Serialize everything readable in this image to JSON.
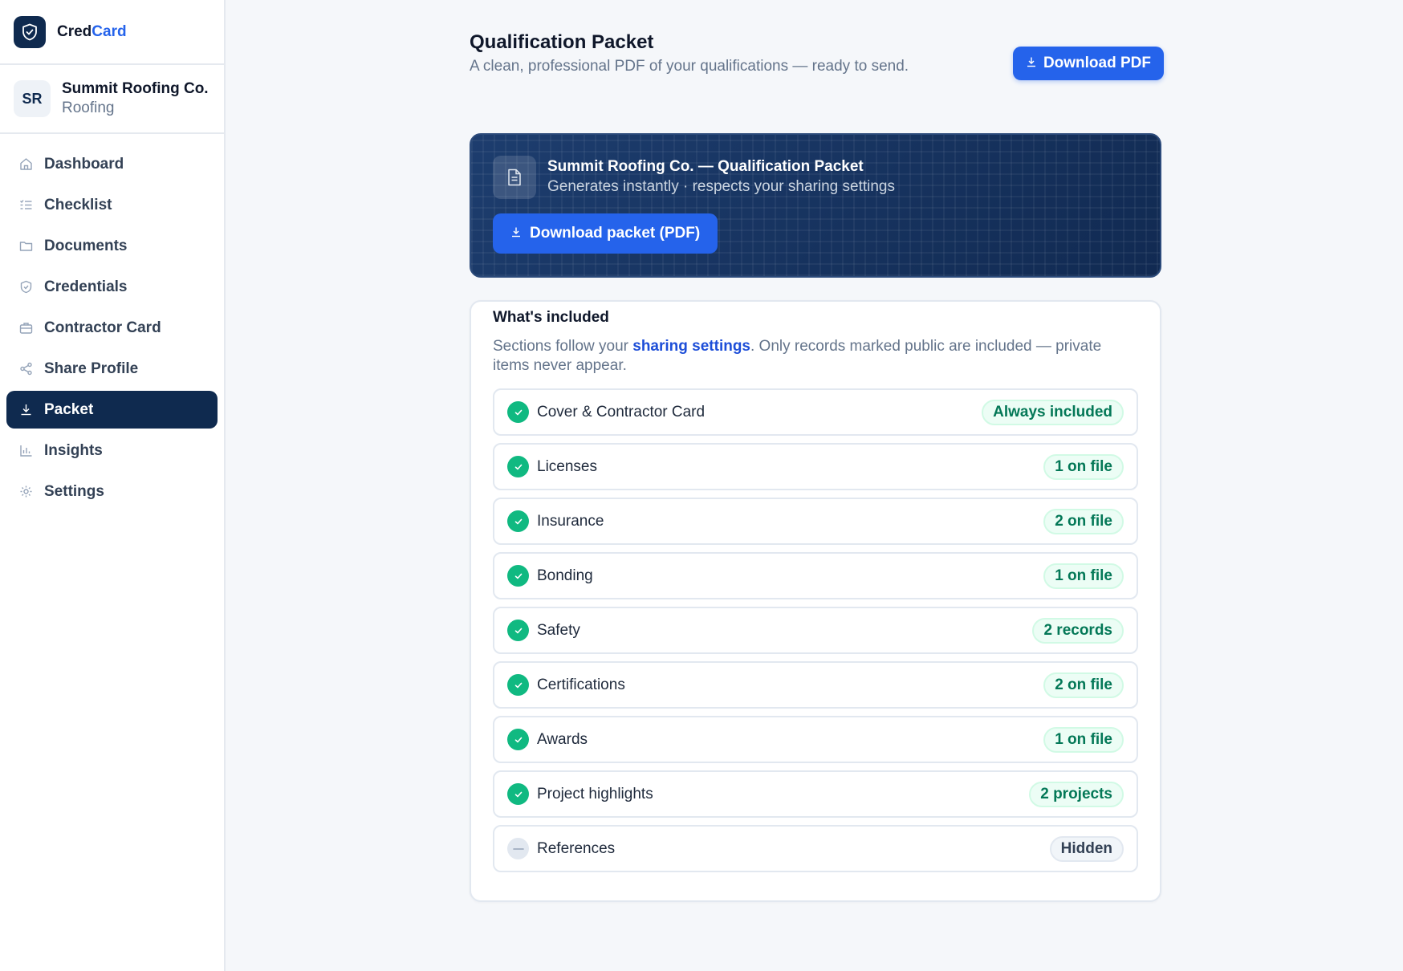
{
  "brand": {
    "name_part1": "Cred",
    "name_part2": "Card",
    "icon": "shield-check-icon"
  },
  "account": {
    "initials": "SR",
    "name": "Summit Roofing Co.",
    "trade": "Roofing"
  },
  "nav": [
    {
      "label": "Dashboard",
      "icon": "home-icon",
      "active": false
    },
    {
      "label": "Checklist",
      "icon": "list-check-icon",
      "active": false
    },
    {
      "label": "Documents",
      "icon": "folder-icon",
      "active": false
    },
    {
      "label": "Credentials",
      "icon": "shield-icon",
      "active": false
    },
    {
      "label": "Contractor Card",
      "icon": "briefcase-icon",
      "active": false
    },
    {
      "label": "Share Profile",
      "icon": "share-icon",
      "active": false
    },
    {
      "label": "Packet",
      "icon": "download-icon",
      "active": true
    },
    {
      "label": "Insights",
      "icon": "bar-chart-icon",
      "active": false
    },
    {
      "label": "Settings",
      "icon": "gear-icon",
      "active": false
    }
  ],
  "header": {
    "title": "Qualification Packet",
    "subtitle": "A clean, professional PDF of your qualifications — ready to send.",
    "download_label": "Download PDF"
  },
  "hero": {
    "title": "Summit Roofing Co. — Qualification Packet",
    "subtitle": "Generates instantly · respects your sharing settings",
    "button_label": "Download packet (PDF)",
    "icon": "document-icon"
  },
  "included": {
    "title": "What's included",
    "desc_before": "Sections follow your ",
    "desc_link": "sharing settings",
    "desc_after": ". Only records marked public are included — private items never appear.",
    "items": [
      {
        "label": "Cover & Contractor Card",
        "badge": "Always included",
        "status": "included"
      },
      {
        "label": "Licenses",
        "badge": "1 on file",
        "status": "included"
      },
      {
        "label": "Insurance",
        "badge": "2 on file",
        "status": "included"
      },
      {
        "label": "Bonding",
        "badge": "1 on file",
        "status": "included"
      },
      {
        "label": "Safety",
        "badge": "2 records",
        "status": "included"
      },
      {
        "label": "Certifications",
        "badge": "2 on file",
        "status": "included"
      },
      {
        "label": "Awards",
        "badge": "1 on file",
        "status": "included"
      },
      {
        "label": "Project highlights",
        "badge": "2 projects",
        "status": "included"
      },
      {
        "label": "References",
        "badge": "Hidden",
        "status": "hidden"
      }
    ]
  },
  "colors": {
    "navy": "#0f2a4f",
    "primary": "#2563eb",
    "success": "#10b981",
    "success_text": "#047857"
  }
}
